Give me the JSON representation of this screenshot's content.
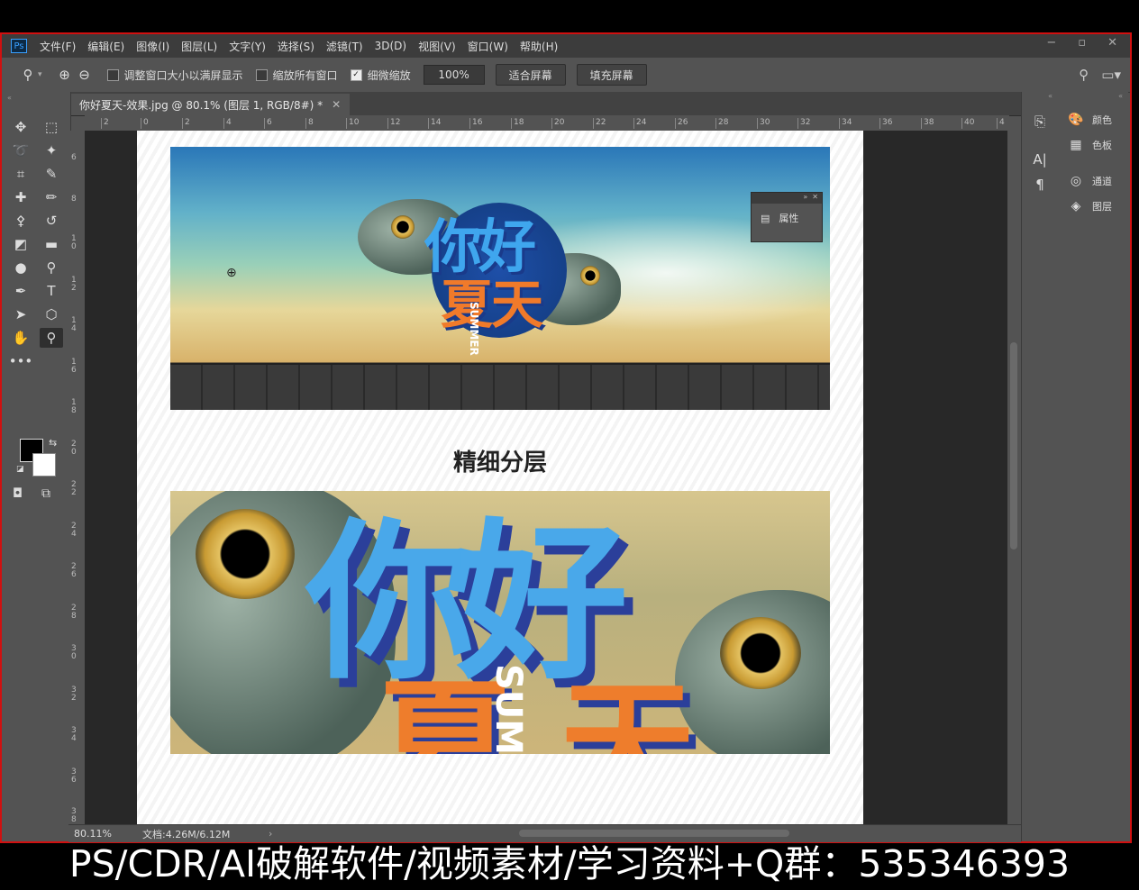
{
  "menubar": {
    "items": [
      "文件(F)",
      "编辑(E)",
      "图像(I)",
      "图层(L)",
      "文字(Y)",
      "选择(S)",
      "滤镜(T)",
      "3D(D)",
      "视图(V)",
      "窗口(W)",
      "帮助(H)"
    ],
    "logo": "Ps"
  },
  "options": {
    "resize_windows": "调整窗口大小以满屏显示",
    "zoom_all": "缩放所有窗口",
    "scrubby_zoom": "细微缩放",
    "zoom_value": "100%",
    "fit_screen": "适合屏幕",
    "fill_screen": "填充屏幕"
  },
  "document": {
    "tab_title": "你好夏天-效果.jpg @ 80.1% (图层 1, RGB/8#) *",
    "section_title": "精细分层",
    "banner_text_1": "你好",
    "banner_text_2": "夏天",
    "banner_summer": "SUMMER",
    "closeup_text": "你好",
    "closeup_text_2": "夏 天",
    "closeup_summer": "SUM"
  },
  "properties_panel": {
    "label": "属性"
  },
  "status": {
    "zoom": "80.11%",
    "doc_size": "文档:4.26M/6.12M"
  },
  "panels": [
    "颜色",
    "色板",
    "通道",
    "图层"
  ],
  "ruler_top": [
    "2",
    "0",
    "2",
    "4",
    "6",
    "8",
    "10",
    "12",
    "14",
    "16",
    "18",
    "20",
    "22",
    "24",
    "26",
    "28",
    "30",
    "32",
    "34",
    "36",
    "38",
    "40",
    "4"
  ],
  "ruler_left": [
    "6",
    "8",
    "10",
    "12",
    "14",
    "16",
    "18",
    "20",
    "22",
    "24",
    "26",
    "28",
    "30",
    "32",
    "34",
    "36",
    "38"
  ],
  "watermark": "PS/CDR/AI破解软件/视频素材/学习资料+Q群：535346393"
}
